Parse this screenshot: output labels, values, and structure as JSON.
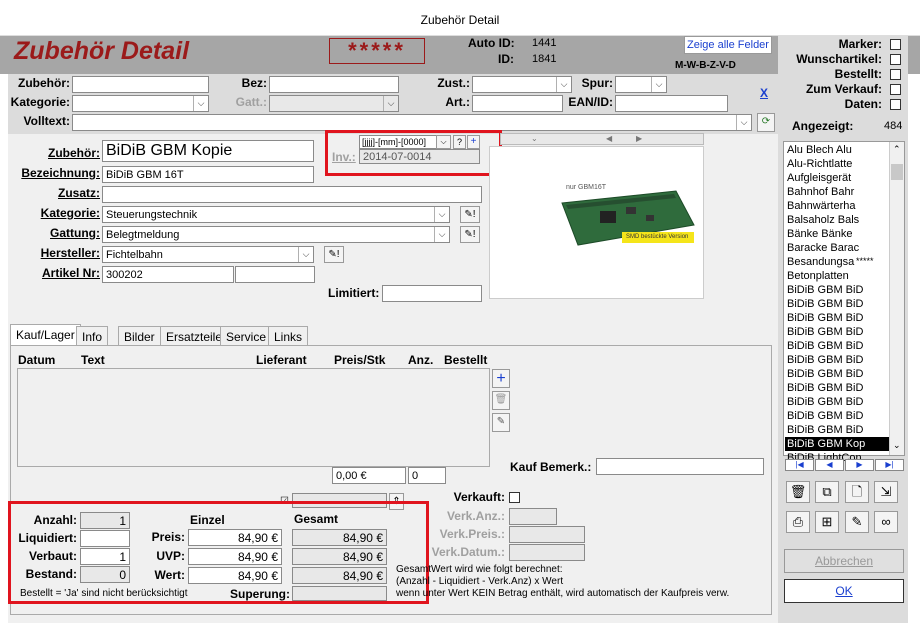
{
  "window": {
    "title": "Zubehör Detail"
  },
  "header": {
    "app_title": "Zubehör Detail",
    "stars": "*****",
    "auto_id_label": "Auto ID:",
    "auto_id_value": "1441",
    "id_label": "ID:",
    "id_value": "1841",
    "show_all_fields_button": "Zeige alle Felder",
    "markers_code": "M-W-B-Z-V-D"
  },
  "flags": [
    {
      "label": "Marker:"
    },
    {
      "label": "Wunschartikel:"
    },
    {
      "label": "Bestellt:"
    },
    {
      "label": "Zum Verkauf:"
    },
    {
      "label": "Daten:"
    }
  ],
  "shown": {
    "label": "Angezeigt:",
    "value": "484"
  },
  "filter": {
    "zubehoer_label": "Zubehör:",
    "bez_label": "Bez:",
    "zust_label": "Zust.:",
    "spur_label": "Spur:",
    "kategorie_label": "Kategorie:",
    "gatt_label": "Gatt.:",
    "art_label": "Art.:",
    "ean_label": "EAN/ID:",
    "volltext_label": "Volltext:",
    "clear_label": "X"
  },
  "detail": {
    "zubehoer_label": "Zubehör:",
    "zubehoer_value": "BiDiB GBM Kopie",
    "inv_label": "Inv.:",
    "inv_format": "[jjjj]-[mm]-[0000]",
    "inv_value": "2014-07-0014",
    "bezeichnung_label": "Bezeichnung:",
    "bezeichnung_value": "BiDiB GBM 16T",
    "zusatz_label": "Zusatz:",
    "zusatz_value": "",
    "kategorie_label": "Kategorie:",
    "kategorie_value": "Steuerungstechnik",
    "gattung_label": "Gattung:",
    "gattung_value": "Belegtmeldung",
    "hersteller_label": "Hersteller:",
    "hersteller_value": "Fichtelbahn",
    "artikel_label": "Artikel Nr:",
    "artikel_value": "300202",
    "limitiert_label": "Limitiert:",
    "image_caption": "nur GBM16T",
    "image_badge": "SMD bestückte Version"
  },
  "tabs": [
    {
      "label": "Kauf/Lager"
    },
    {
      "label": "Info"
    },
    {
      "label": "Bilder"
    },
    {
      "label": "Ersatzteile"
    },
    {
      "label": "Service"
    },
    {
      "label": "Links"
    }
  ],
  "purchase_table": {
    "columns": [
      "Datum",
      "Text",
      "Lieferant",
      "Preis/Stk",
      "Anz.",
      "Bestellt"
    ],
    "total_value": "0,00 €",
    "total_count": "0",
    "kauf_bemerk_label": "Kauf Bemerk.:"
  },
  "stock": {
    "anzahl_label": "Anzahl:",
    "anzahl_value": "1",
    "liquidiert_label": "Liquidiert:",
    "liquidiert_value": "",
    "verbaut_label": "Verbaut:",
    "verbaut_value": "1",
    "bestand_label": "Bestand:",
    "bestand_value": "0",
    "einzel_label": "Einzel",
    "gesamt_label": "Gesamt",
    "preis_label": "Preis:",
    "preis_einzel": "84,90 €",
    "preis_gesamt": "84,90 €",
    "uvp_label": "UVP:",
    "uvp_einzel": "84,90 €",
    "uvp_gesamt": "84,90 €",
    "wert_label": "Wert:",
    "wert_einzel": "84,90 €",
    "wert_gesamt": "84,90 €",
    "note": "Bestellt = 'Ja' sind nicht berücksichtigt",
    "superung_label": "Superung:"
  },
  "sale": {
    "verkauft_label": "Verkauft:",
    "anz_label": "Verk.Anz.:",
    "preis_label": "Verk.Preis.:",
    "datum_label": "Verk.Datum.:",
    "info_line1": "GesamtWert wird wie folgt berechnet:",
    "info_line2": "(Anzahl - Liquidiert - Verk.Anz) x Wert",
    "info_line3": "wenn unter Wert KEIN Betrag enthält, wird automatisch der Kaufpreis verw."
  },
  "list": {
    "items": [
      "Alu Blech Alu",
      "Alu-Richtlatte",
      "Aufgleisgerät",
      "Bahnhof Bahr",
      "Bahnwärterha",
      "Balsaholz Bals",
      "Bänke Bänke",
      "Baracke Barac",
      "Besandungsa",
      "Betonplatten",
      "BiDiB GBM BiD",
      "BiDiB GBM BiD",
      "BiDiB GBM BiD",
      "BiDiB GBM BiD",
      "BiDiB GBM BiD",
      "BiDiB GBM BiD",
      "BiDiB GBM BiD",
      "BiDiB GBM BiD",
      "BiDiB GBM BiD",
      "BiDiB GBM BiD",
      "BiDiB GBM BiD",
      "BiDiB GBM Kop",
      "BiDiB LightCon"
    ],
    "selected_index": 21,
    "star_marker": "*****"
  },
  "buttons": {
    "abbrechen": "Abbrechen",
    "ok": "OK"
  },
  "colors": {
    "accent_red": "#e0141e",
    "title_red": "#9b1a1a",
    "header_gray": "#a6a6a6"
  }
}
